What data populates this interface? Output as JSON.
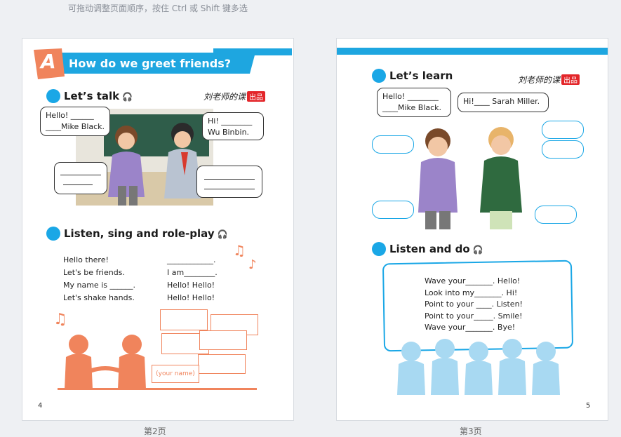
{
  "hint": "可拖动调整页面顺序，按住 Ctrl 或 Shift 键多选",
  "left_page": {
    "section_letter": "A",
    "title": "How do we greet friends?",
    "lets_talk": "Let’s talk",
    "brand": "刘老师的课",
    "brand_tag": "出品",
    "bubble1_line1": "Hello! ______",
    "bubble1_line2": "____Mike Black.",
    "bubble2_line1": "Hi! ________",
    "bubble2_line2": "Wu Binbin.",
    "listen_sing": "Listen, sing and role-play",
    "song_left": [
      "Hello there!",
      "Let's be friends.",
      "My name is ______.",
      "Let's shake hands."
    ],
    "song_right": [
      "____________.",
      "I am________.",
      "Hello! Hello!",
      "Hello! Hello!"
    ],
    "your_name": "(your name)",
    "page_number": "4",
    "caption": "第2页"
  },
  "right_page": {
    "lets_learn": "Let’s learn",
    "brand": "刘老师的课",
    "brand_tag": "出品",
    "bubble1_line1": "Hello! ________",
    "bubble1_line2": "____Mike Black.",
    "bubble2_line1": "Hi!____ Sarah Miller.",
    "listen_do": "Listen and do",
    "lines": [
      "Wave your_______. Hello!",
      "Look into my_______. Hi!",
      "Point to your ____. Listen!",
      "Point to your_____. Smile!",
      "Wave your_______. Bye!"
    ],
    "page_number": "5",
    "caption": "第3页"
  },
  "colors": {
    "accent": "#1aa7e6",
    "orange": "#f0845c",
    "banner": "#1ea6e0"
  }
}
